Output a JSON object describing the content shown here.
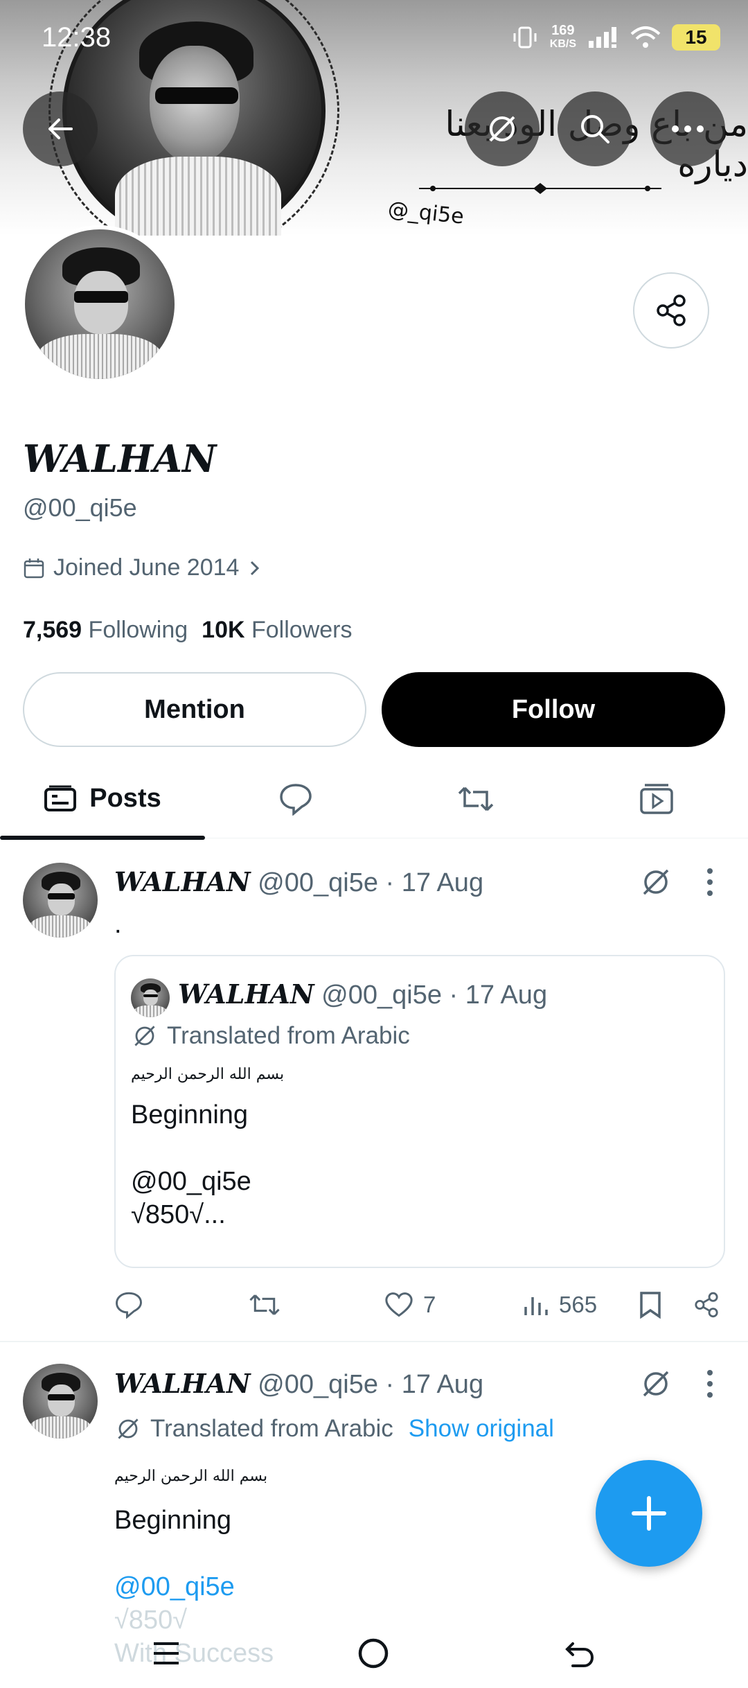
{
  "status_bar": {
    "time": "12:38",
    "speed_value": "169",
    "speed_unit": "KB/S",
    "battery": "15"
  },
  "banner": {
    "arabic_text": "من باع وصل الود بعنا دياره",
    "handle": "@_qi5e"
  },
  "profile": {
    "name": "WALHAN",
    "handle": "@00_qi5e",
    "joined": "Joined June 2014",
    "following_count": "7,569",
    "following_label": "Following",
    "followers_count": "10K",
    "followers_label": "Followers"
  },
  "actions": {
    "mention": "Mention",
    "follow": "Follow"
  },
  "tabs": {
    "posts": "Posts"
  },
  "posts": [
    {
      "name": "WALHAN",
      "handle_date": "@00_qi5e · 17 Aug",
      "text": ".",
      "quote": {
        "name": "WALHAN",
        "handle_date": "@00_qi5e · 17 Aug",
        "translated": "Translated from Arabic",
        "basmala": "بسم الله الرحمن الرحيم",
        "line1": "Beginning",
        "line2": "@00_qi5e",
        "line3": "√850√..."
      },
      "likes": "7",
      "views": "565"
    },
    {
      "name": "WALHAN",
      "handle_date": "@00_qi5e · 17 Aug",
      "translated": "Translated from Arabic",
      "show_original": "Show original",
      "basmala": "بسم الله الرحمن الرحيم",
      "line1": "Beginning",
      "mention": "@00_qi5e",
      "line3": "√850√",
      "line4": "With Success"
    }
  ],
  "colors": {
    "accent": "#1d9bf0",
    "text": "#0f1419",
    "secondary": "#536471",
    "battery": "#f1e36a"
  }
}
